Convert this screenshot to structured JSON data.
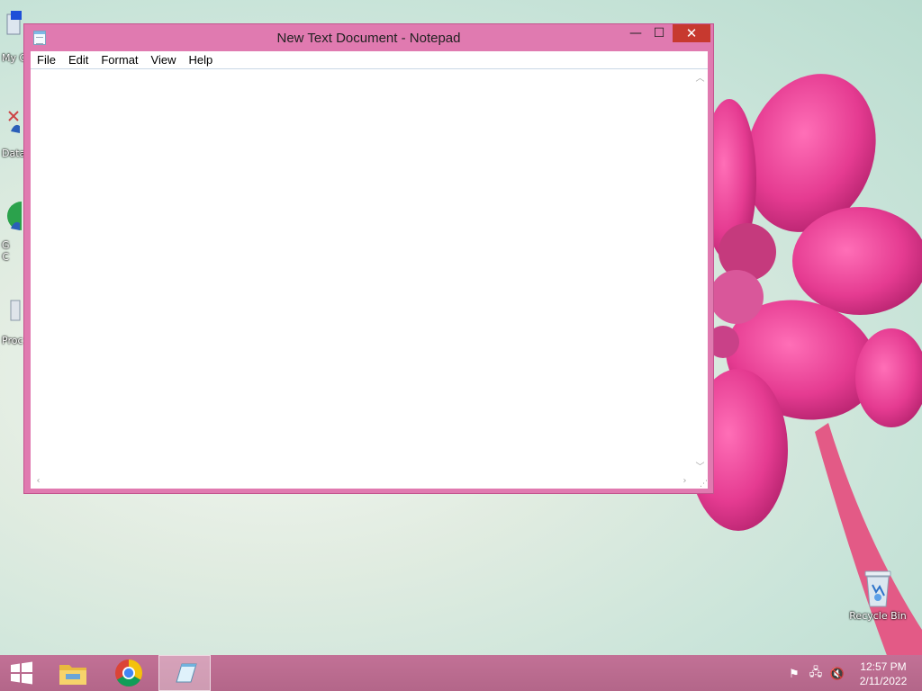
{
  "window": {
    "title": "New Text Document - Notepad",
    "controls": {
      "minimize": "—",
      "maximize": "☐",
      "close": "✕"
    },
    "menu": [
      "File",
      "Edit",
      "Format",
      "View",
      "Help"
    ],
    "content": ""
  },
  "desktop": {
    "left_icons": [
      {
        "label": "My C",
        "icon": "computer-icon"
      },
      {
        "label": "Data",
        "icon": "database-shortcut-icon"
      },
      {
        "label": "G\nC",
        "icon": "chrome-shortcut-icon"
      },
      {
        "label": "Proc",
        "icon": "program-shortcut-icon"
      }
    ],
    "recycle_bin": {
      "label": "Recycle Bin",
      "icon": "recycle-bin-icon"
    }
  },
  "taskbar": {
    "apps": [
      {
        "name": "start",
        "icon": "windows-logo-icon"
      },
      {
        "name": "file-explorer",
        "icon": "folder-icon"
      },
      {
        "name": "chrome",
        "icon": "chrome-icon"
      },
      {
        "name": "notepad",
        "icon": "notepad-icon",
        "active": true
      }
    ],
    "tray": {
      "icons": [
        "action-center-flag-icon",
        "network-icon",
        "speaker-muted-icon"
      ],
      "time": "12:57 PM",
      "date": "2/11/2022"
    }
  },
  "colors": {
    "window_frame": "#e07ab0",
    "taskbar": "#b96b8f",
    "close_button": "#c7392f"
  }
}
